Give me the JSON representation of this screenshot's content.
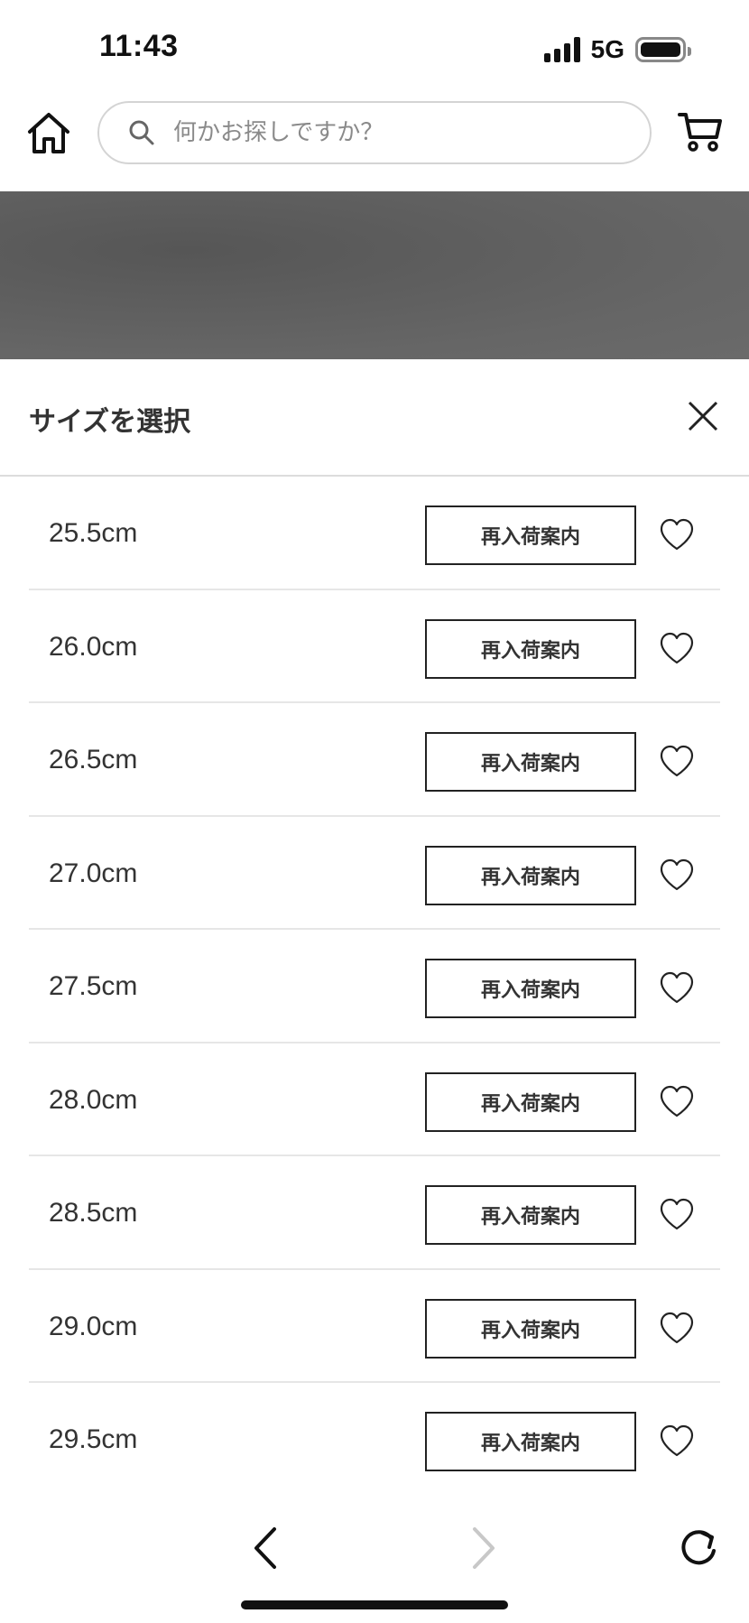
{
  "status_bar": {
    "time": "11:43",
    "network": "5G"
  },
  "header": {
    "home_icon": "home-icon",
    "search": {
      "placeholder": "何かお探しですか？",
      "value": ""
    },
    "cart_icon": "cart-icon"
  },
  "sheet": {
    "title": "サイズを選択",
    "close_icon": "close-icon",
    "sizes": [
      {
        "label": "25.5cm",
        "button": "再入荷案内"
      },
      {
        "label": "26.0cm",
        "button": "再入荷案内"
      },
      {
        "label": "26.5cm",
        "button": "再入荷案内"
      },
      {
        "label": "27.0cm",
        "button": "再入荷案内"
      },
      {
        "label": "27.5cm",
        "button": "再入荷案内"
      },
      {
        "label": "28.0cm",
        "button": "再入荷案内"
      },
      {
        "label": "28.5cm",
        "button": "再入荷案内"
      },
      {
        "label": "29.0cm",
        "button": "再入荷案内"
      },
      {
        "label": "29.5cm",
        "button": "再入荷案内"
      }
    ]
  },
  "bottom_nav": {
    "back_icon": "chevron-left-icon",
    "forward_icon": "chevron-right-icon",
    "reload_icon": "reload-icon"
  },
  "colors": {
    "text": "#333333",
    "border": "#222222",
    "overlay": "#666666",
    "disabled": "#c8c8c8"
  }
}
